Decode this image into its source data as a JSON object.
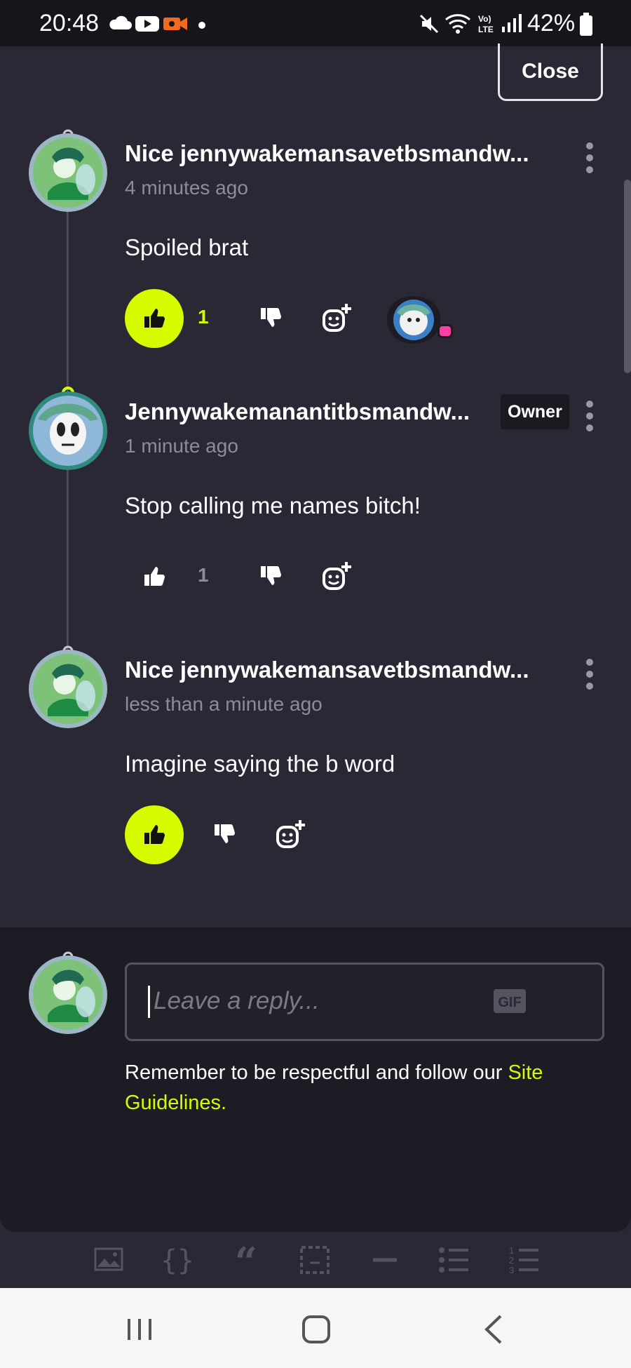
{
  "status_bar": {
    "time": "20:48",
    "battery": "42%",
    "icons": [
      "cloud-icon",
      "youtube-icon",
      "screen-recorder-icon",
      "dot-icon",
      "mute-icon",
      "wifi-icon",
      "volte-icon",
      "signal-icon",
      "battery-icon"
    ]
  },
  "header": {
    "close_label": "Close"
  },
  "comments": [
    {
      "author": "Nice jennywakemansavetbsmandw...",
      "time": "4 minutes ago",
      "body": "Spoiled brat",
      "likes": "1",
      "liked": true
    },
    {
      "author": "Jennywakemanantitbsmandw...",
      "badge": "Owner",
      "time": "1 minute ago",
      "body": "Stop calling me names bitch!",
      "likes": "1",
      "liked": false
    },
    {
      "author": "Nice jennywakemansavetbsmandw...",
      "time": "less than a minute ago",
      "body": "Imagine saying the b word",
      "likes": "",
      "liked": true
    }
  ],
  "reply": {
    "placeholder": "Leave a reply...",
    "gif_label": "GIF",
    "note_prefix": "Remember to be respectful and follow our ",
    "note_link": "Site Guidelines",
    "note_suffix": "."
  },
  "toolbar_icons": [
    "image-icon",
    "code-braces-icon",
    "quote-icon",
    "spoiler-icon",
    "horizontal-rule-icon",
    "bullet-list-icon",
    "numbered-list-icon"
  ],
  "colors": {
    "accent": "#d6fb00",
    "background": "#2a2834",
    "panel": "#1d1c24"
  }
}
